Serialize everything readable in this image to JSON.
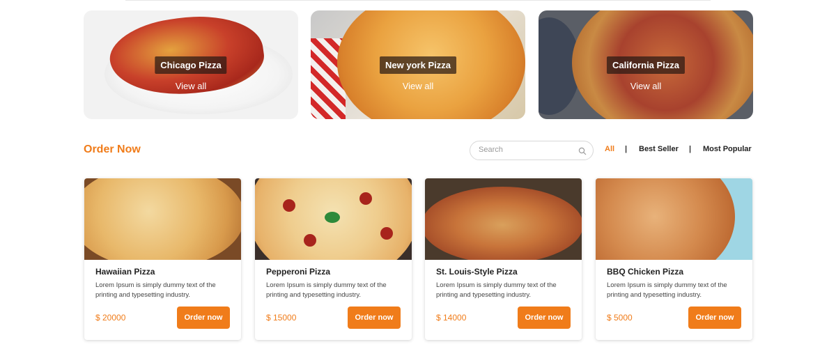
{
  "categories": [
    {
      "title": "Chicago Pizza",
      "link": "View all"
    },
    {
      "title": "New york Pizza",
      "link": "View all"
    },
    {
      "title": "California Pizza",
      "link": "View all"
    }
  ],
  "order": {
    "title": "Order Now",
    "search_placeholder": "Search",
    "filters": [
      "All",
      "Best Seller",
      "Most Popular"
    ],
    "separator": "|"
  },
  "products": [
    {
      "name": "Hawaiian Pizza",
      "desc": "Lorem Ipsum is simply dummy text of the printing and typesetting industry.",
      "price": "$ 20000",
      "button": "Order now"
    },
    {
      "name": "Pepperoni Pizza",
      "desc": "Lorem Ipsum is simply dummy text of the printing and typesetting industry.",
      "price": "$ 15000",
      "button": "Order now"
    },
    {
      "name": "St. Louis-Style Pizza",
      "desc": "Lorem Ipsum is simply dummy text of the printing and typesetting industry.",
      "price": "$ 14000",
      "button": "Order now"
    },
    {
      "name": "BBQ Chicken Pizza",
      "desc": "Lorem Ipsum is simply dummy text of the printing and typesetting industry.",
      "price": "$ 5000",
      "button": "Order now"
    }
  ],
  "colors": {
    "accent": "#f07c1a"
  }
}
